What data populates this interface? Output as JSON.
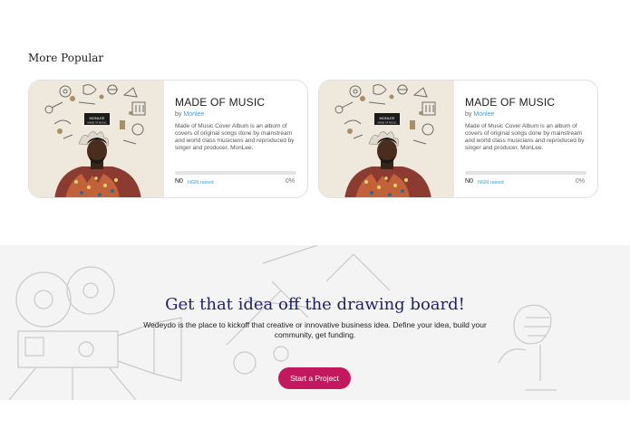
{
  "popular": {
    "title": "More Popular",
    "cards": [
      {
        "image_alt": "Made of Music album cover",
        "cover_text_1": "MONLEE",
        "cover_text_2": "MADE OF MUSIC",
        "title": "MADE OF MUSIC",
        "by_label": "by",
        "author": "Monlee",
        "description": "Made of Music Cover Album is an album of covers of original songs done by mainstream and world class musicians and reproduced by singer and producer, MonLee.",
        "raised_amount": "N0",
        "raised_label": "NGN raised",
        "percent_label": "0%",
        "progress": 0
      },
      {
        "image_alt": "Made of Music album cover",
        "cover_text_1": "MONLEE",
        "cover_text_2": "MADE OF MUSIC",
        "title": "MADE OF MUSIC",
        "by_label": "by",
        "author": "Monlee",
        "description": "Made of Music Cover Album is an album of covers of original songs done by mainstream and world class musicians and reproduced by singer and producer, MonLee.",
        "raised_amount": "N0",
        "raised_label": "NGN raised",
        "percent_label": "0%",
        "progress": 0
      }
    ]
  },
  "banner": {
    "title": "Get that idea off the drawing board!",
    "text": "Wedeydo is the place to kickoff that creative or innovative business idea. Define your idea, build your community, get funding.",
    "button_label": "Start a Project"
  },
  "colors": {
    "accent": "#c4185e",
    "link": "#3a9fd6",
    "heading": "#1d1f6b",
    "banner_bg": "#f4f4f5"
  }
}
